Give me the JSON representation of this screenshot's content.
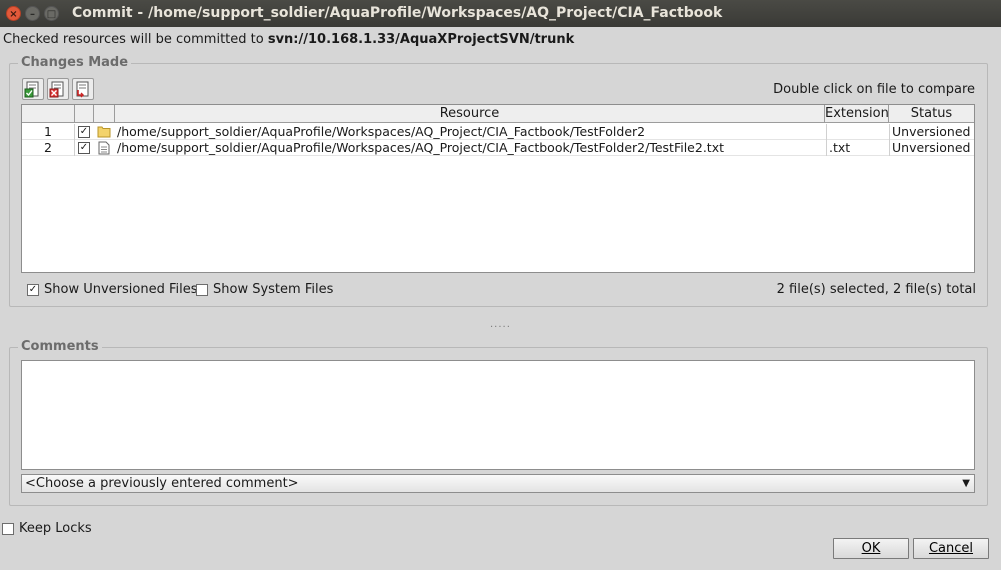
{
  "window": {
    "title": "Commit - /home/support_soldier/AquaProfile/Workspaces/AQ_Project/CIA_Factbook",
    "close_glyph": "×",
    "min_glyph": "–",
    "max_glyph": "□"
  },
  "info": {
    "prefix": "Checked resources will be committed to ",
    "url": "svn://10.168.1.33/AquaXProjectSVN/trunk"
  },
  "changes": {
    "group_title": "Changes Made",
    "hint": "Double click on file to compare",
    "columns": {
      "resource": "Resource",
      "extension": "Extension",
      "status": "Status"
    },
    "rows": [
      {
        "num": "1",
        "checked": "✓",
        "icon": "folder-icon",
        "path": "/home/support_soldier/AquaProfile/Workspaces/AQ_Project/CIA_Factbook/TestFolder2",
        "extension": "",
        "status": "Unversioned"
      },
      {
        "num": "2",
        "checked": "✓",
        "icon": "file-icon",
        "path": "/home/support_soldier/AquaProfile/Workspaces/AQ_Project/CIA_Factbook/TestFolder2/TestFile2.txt",
        "extension": ".txt",
        "status": "Unversioned"
      }
    ],
    "show_unversioned_label": "Show Unversioned Files",
    "show_unversioned_check": "✓",
    "show_system_label": "Show System Files",
    "summary": "2 file(s) selected, 2 file(s) total"
  },
  "splitter": "·····",
  "comments": {
    "group_title": "Comments",
    "value": "",
    "combo_value": "<Choose a previously entered comment>",
    "combo_arrow": "▼"
  },
  "keep_locks_label": "Keep Locks",
  "buttons": {
    "ok": "OK",
    "cancel": "Cancel"
  },
  "colors": {
    "titlebar": "#3f3f3b",
    "close_button": "#e2593a",
    "window_bg": "#d6d6d6"
  }
}
